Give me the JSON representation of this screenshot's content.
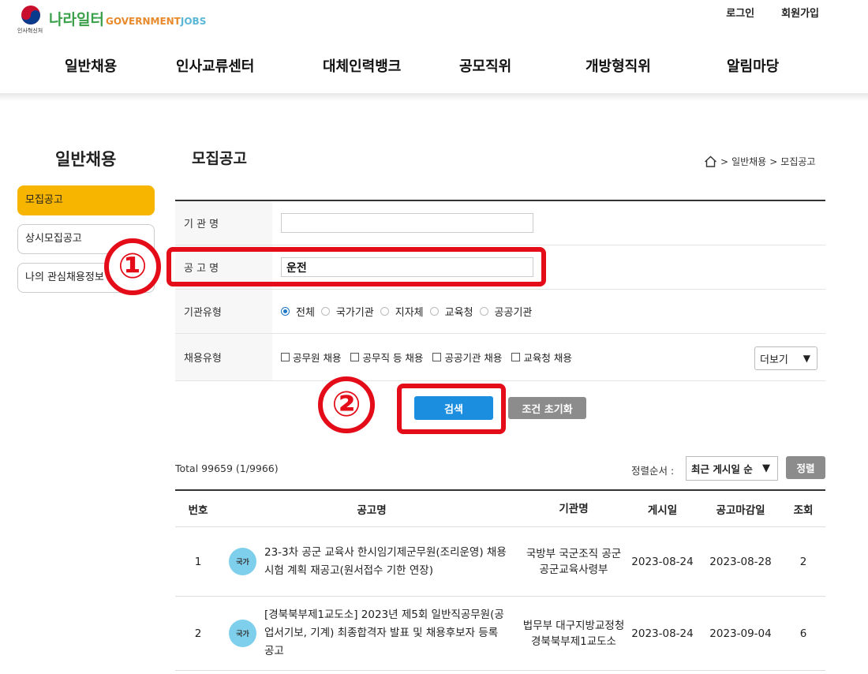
{
  "header": {
    "logo_org": "인사혁신처",
    "logo_brand": "나라일터",
    "logo_en_gov": "GOVERNMENT",
    "logo_en_jobs": "JOBS",
    "login": "로그인",
    "signup": "회원가입",
    "nav": [
      "일반채용",
      "인사교류센터",
      "대체인력뱅크",
      "공모직위",
      "개방형직위",
      "알림마당"
    ]
  },
  "sidebar": {
    "title": "일반채용",
    "items": [
      {
        "label": "모집공고",
        "active": true
      },
      {
        "label": "상시모집공고",
        "active": false
      },
      {
        "label": "나의 관심채용정보",
        "active": false
      }
    ]
  },
  "content": {
    "title": "모집공고",
    "breadcrumb": [
      "일반채용",
      "모집공고"
    ],
    "breadcrumb_sep": ">"
  },
  "search_form": {
    "org_label": "기 관 명",
    "org_value": "",
    "notice_label": "공 고 명",
    "notice_value": "운전",
    "org_type_label": "기관유형",
    "org_types": [
      {
        "label": "전체",
        "selected": true
      },
      {
        "label": "국가기관",
        "selected": false
      },
      {
        "label": "지자체",
        "selected": false
      },
      {
        "label": "교육청",
        "selected": false
      },
      {
        "label": "공공기관",
        "selected": false
      }
    ],
    "hire_type_label": "채용유형",
    "hire_types": [
      "공무원 채용",
      "공무직 등 채용",
      "공공기관 채용",
      "교육청 채용"
    ],
    "more_label": "더보기",
    "search_button": "검색",
    "reset_button": "조건 초기화"
  },
  "annotations": {
    "step1": "①",
    "step2": "②",
    "color": "#e30c18"
  },
  "results": {
    "total": "Total 99659 (1/9966)",
    "sort_label": "정렬순서 :",
    "sort_value": "최근 게시일 순",
    "sort_button": "정렬",
    "columns": [
      "번호",
      "공고명",
      "기관명",
      "게시일",
      "공고마감일",
      "조회"
    ],
    "rows": [
      {
        "no": "1",
        "badge": "국가",
        "title": "23-3차 공군 교육사 한시임기제군무원(조리운영) 채용 시험 계획 재공고(원서접수 기한 연장)",
        "org": "국방부 국군조직 공군 공군교육사령부",
        "posted": "2023-08-24",
        "deadline": "2023-08-28",
        "views": "2"
      },
      {
        "no": "2",
        "badge": "국가",
        "title": "[경북북부제1교도소] 2023년 제5회 일반직공무원(공업서기보, 기계) 최종합격자 발표 및 채용후보자 등록 공고",
        "org": "법무부 대구지방교정청 경북북부제1교도소",
        "posted": "2023-08-24",
        "deadline": "2023-09-04",
        "views": "6"
      }
    ]
  },
  "colors": {
    "accent": "#f7b500",
    "primary": "#1c8edf",
    "badge": "#7ecfec",
    "gray_button": "#8c8c8c"
  }
}
